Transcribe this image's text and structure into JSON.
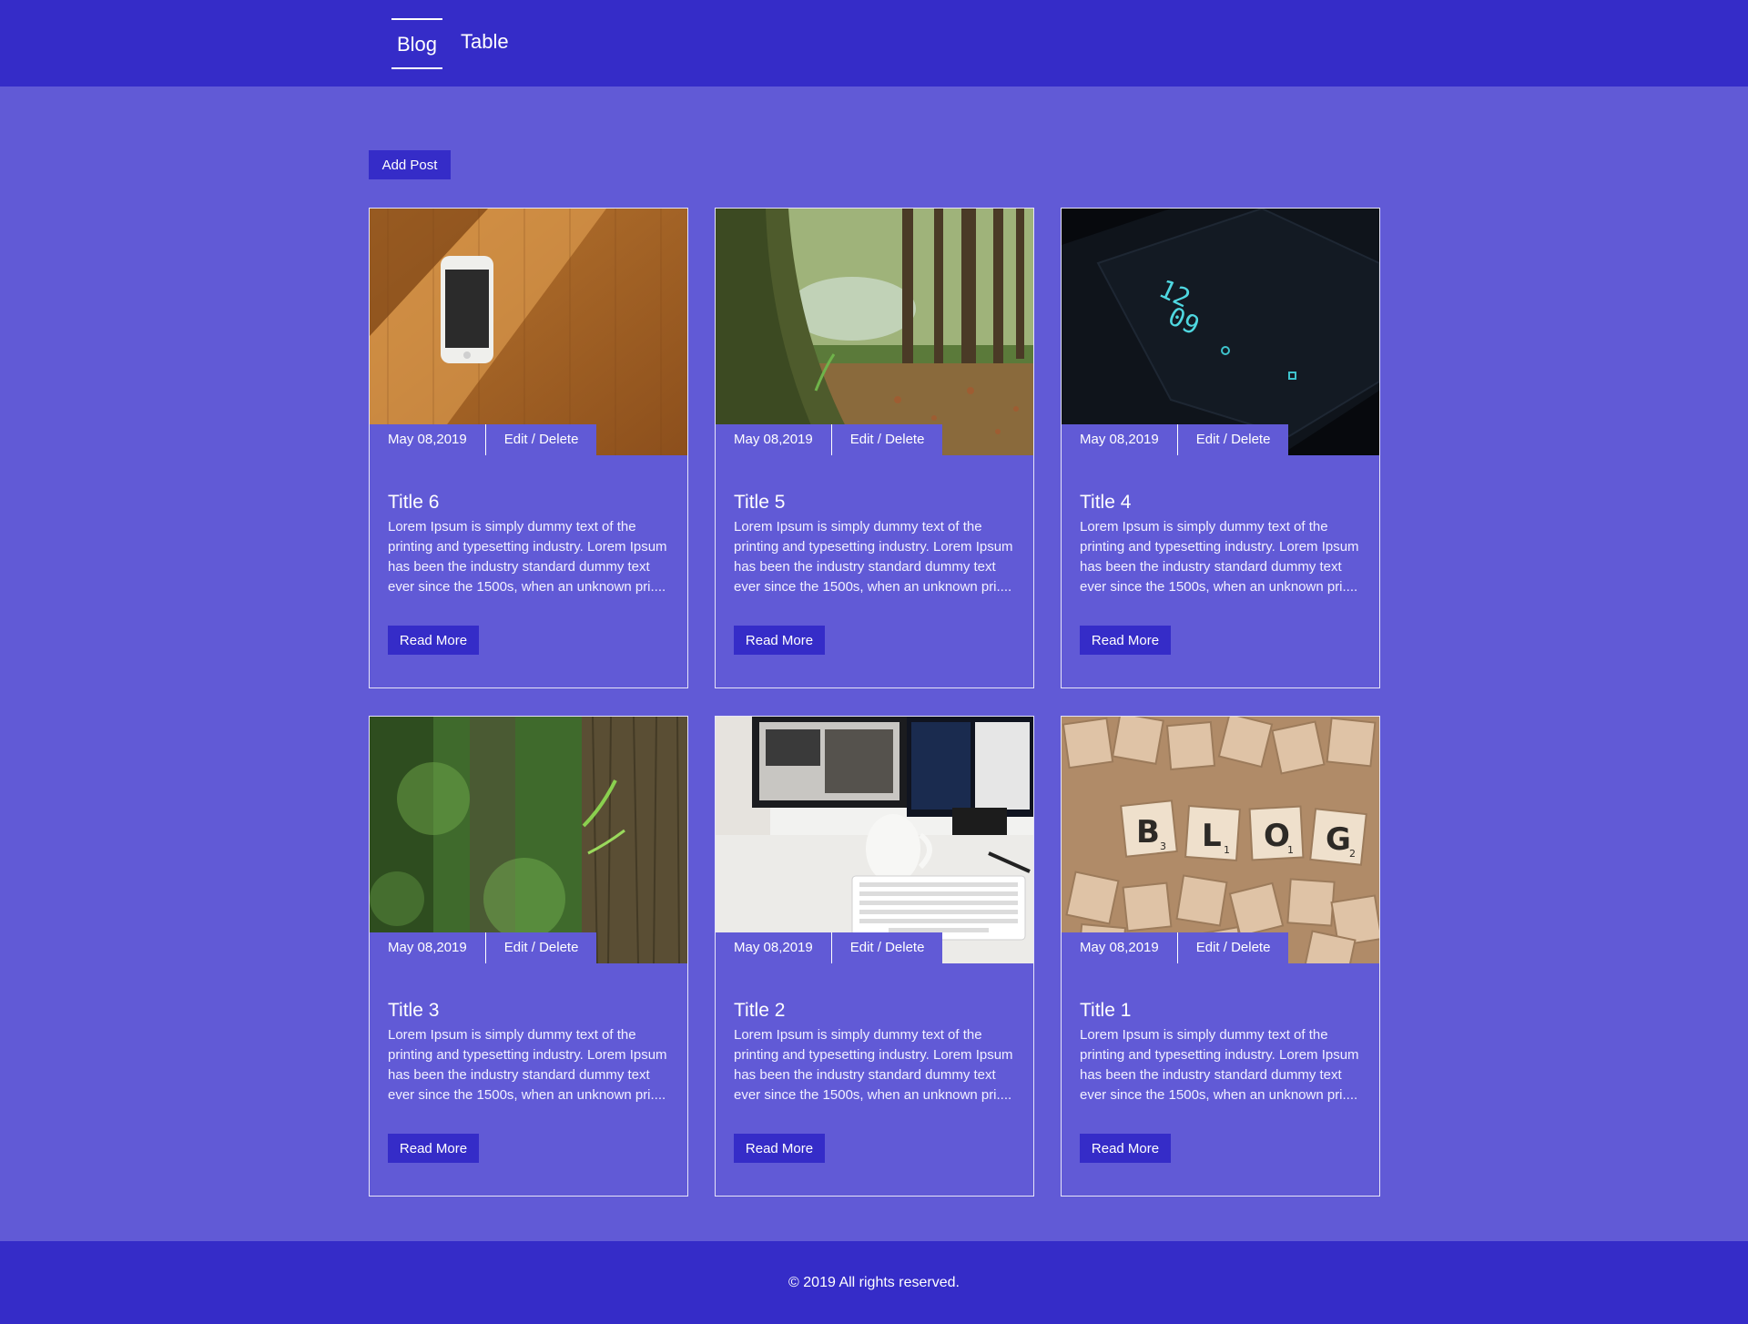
{
  "nav": {
    "items": [
      {
        "label": "Blog",
        "active": true
      },
      {
        "label": "Table",
        "active": false
      }
    ]
  },
  "toolbar": {
    "add_post_label": "Add Post"
  },
  "posts": [
    {
      "date": "May 08,2019",
      "actions_label": "Edit / Delete",
      "title": "Title 6",
      "excerpt": "Lorem Ipsum is simply dummy text of the printing and typesetting industry. Lorem Ipsum has been the industry standard dummy text ever since the 1500s, when an unknown pri....",
      "read_more_label": "Read More",
      "image": "phone-on-wooden-desk"
    },
    {
      "date": "May 08,2019",
      "actions_label": "Edit / Delete",
      "title": "Title 5",
      "excerpt": "Lorem Ipsum is simply dummy text of the printing and typesetting industry. Lorem Ipsum has been the industry standard dummy text ever since the 1500s, when an unknown pri....",
      "read_more_label": "Read More",
      "image": "forest-tree-trunk"
    },
    {
      "date": "May 08,2019",
      "actions_label": "Edit / Delete",
      "title": "Title 4",
      "excerpt": "Lorem Ipsum is simply dummy text of the printing and typesetting industry. Lorem Ipsum has been the industry standard dummy text ever since the 1500s, when an unknown pri....",
      "read_more_label": "Read More",
      "image": "dark-phone-clock"
    },
    {
      "date": "May 08,2019",
      "actions_label": "Edit / Delete",
      "title": "Title 3",
      "excerpt": "Lorem Ipsum is simply dummy text of the printing and typesetting industry. Lorem Ipsum has been the industry standard dummy text ever since the 1500s, when an unknown pri....",
      "read_more_label": "Read More",
      "image": "tree-bark-green-blur"
    },
    {
      "date": "May 08,2019",
      "actions_label": "Edit / Delete",
      "title": "Title 2",
      "excerpt": "Lorem Ipsum is simply dummy text of the printing and typesetting industry. Lorem Ipsum has been the industry standard dummy text ever since the 1500s, when an unknown pri....",
      "read_more_label": "Read More",
      "image": "desk-monitor-mug-keyboard"
    },
    {
      "date": "May 08,2019",
      "actions_label": "Edit / Delete",
      "title": "Title 1",
      "excerpt": "Lorem Ipsum is simply dummy text of the printing and typesetting industry. Lorem Ipsum has been the industry standard dummy text ever since the 1500s, when an unknown pri....",
      "read_more_label": "Read More",
      "image": "scrabble-blog-tiles"
    }
  ],
  "images": {
    "dark_phone_clock": [
      "12",
      "09"
    ],
    "scrabble_tiles": [
      {
        "letter": "B",
        "score": "3"
      },
      {
        "letter": "L",
        "score": "1"
      },
      {
        "letter": "O",
        "score": "1"
      },
      {
        "letter": "G",
        "score": "2"
      }
    ]
  },
  "footer": {
    "copyright": "© 2019 All rights reserved."
  },
  "colors": {
    "header": "#352cc8",
    "page": "#615ad6",
    "button": "#352cc8",
    "card_border": "#e6e4f8"
  }
}
